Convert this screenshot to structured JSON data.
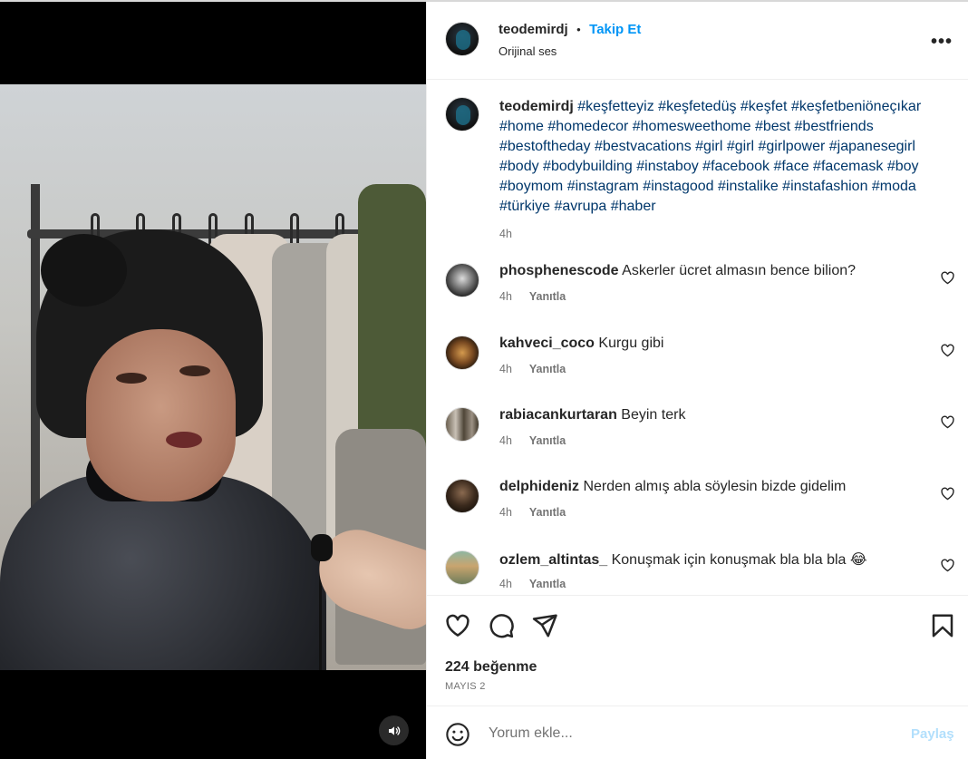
{
  "post": {
    "username": "teodemirdj",
    "dot": "•",
    "follow_label": "Takip Et",
    "audio": "Orijinal ses",
    "more_label": "•••"
  },
  "caption": {
    "username": "teodemirdj",
    "text": "#keşfetteyiz #keşfetedüş #keşfet #keşfetbeniöneçıkar #home #homedecor #homesweethome #best #bestfriends #bestoftheday #bestvacations #girl #girl #girlpower #japanesegirl #body #bodybuilding #instaboy #facebook #face #facemask #boy #boymom #instagram #instagood #instalike #instafashion #moda #türkiye #avrupa #haber",
    "time": "4h"
  },
  "comments": [
    {
      "username": "phosphenescode",
      "text": "Askerler ücret almasın bence bilion?",
      "time": "4h",
      "reply": "Yanıtla"
    },
    {
      "username": "kahveci_coco",
      "text": "Kurgu gibi",
      "time": "4h",
      "reply": "Yanıtla"
    },
    {
      "username": "rabiacankurtaran",
      "text": "Beyin terk",
      "time": "4h",
      "reply": "Yanıtla"
    },
    {
      "username": "delphideniz",
      "text": "Nerden almış abla söylesin bizde gidelim",
      "time": "4h",
      "reply": "Yanıtla"
    },
    {
      "username": "ozlem_altintas_",
      "text": "Konuşmak için konuşmak bla bla bla 😂",
      "time": "4h",
      "reply": "Yanıtla"
    }
  ],
  "stats": {
    "likes": "224 beğenme",
    "date": "MAYIS 2"
  },
  "composer": {
    "placeholder": "Yorum ekle...",
    "post_label": "Paylaş"
  },
  "colors": {
    "accent": "#0095f6",
    "hashtag": "#00376b",
    "muted": "#737373",
    "post_disabled": "#b2dffc"
  },
  "icons": {
    "like": "heart-icon",
    "comment": "comment-icon",
    "share": "paper-plane-icon",
    "save": "bookmark-icon",
    "sound": "speaker-icon",
    "emoji": "emoji-icon"
  }
}
